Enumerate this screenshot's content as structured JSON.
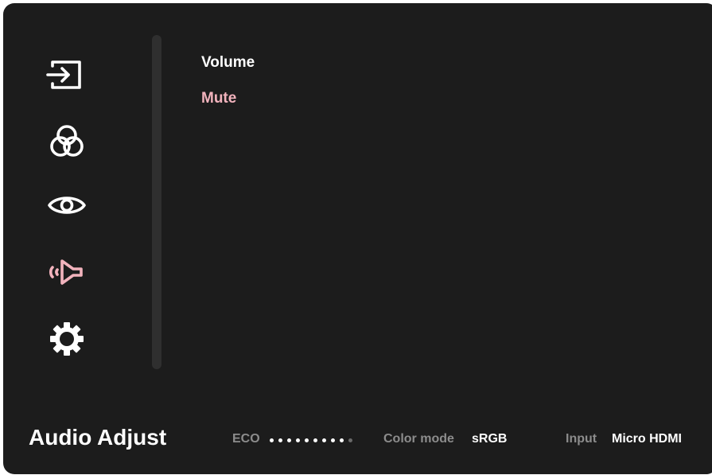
{
  "sidebar": {
    "icons": [
      {
        "name": "input-icon",
        "selected": false
      },
      {
        "name": "color-icon",
        "selected": false
      },
      {
        "name": "view-icon",
        "selected": false
      },
      {
        "name": "audio-icon",
        "selected": true
      },
      {
        "name": "setup-icon",
        "selected": false
      }
    ]
  },
  "menu": {
    "items": [
      {
        "label": "Volume",
        "selected": false
      },
      {
        "label": "Mute",
        "selected": true
      }
    ]
  },
  "footer": {
    "title": "Audio Adjust",
    "eco_label": "ECO",
    "eco_level": 9,
    "eco_max": 10,
    "color_mode_label": "Color mode",
    "color_mode_value": "sRGB",
    "input_label": "Input",
    "input_value": "Micro HDMI"
  },
  "colors": {
    "background": "#1c1c1c",
    "text": "#ffffff",
    "accent": "#f2b3bd",
    "muted": "#8c8c8c"
  }
}
